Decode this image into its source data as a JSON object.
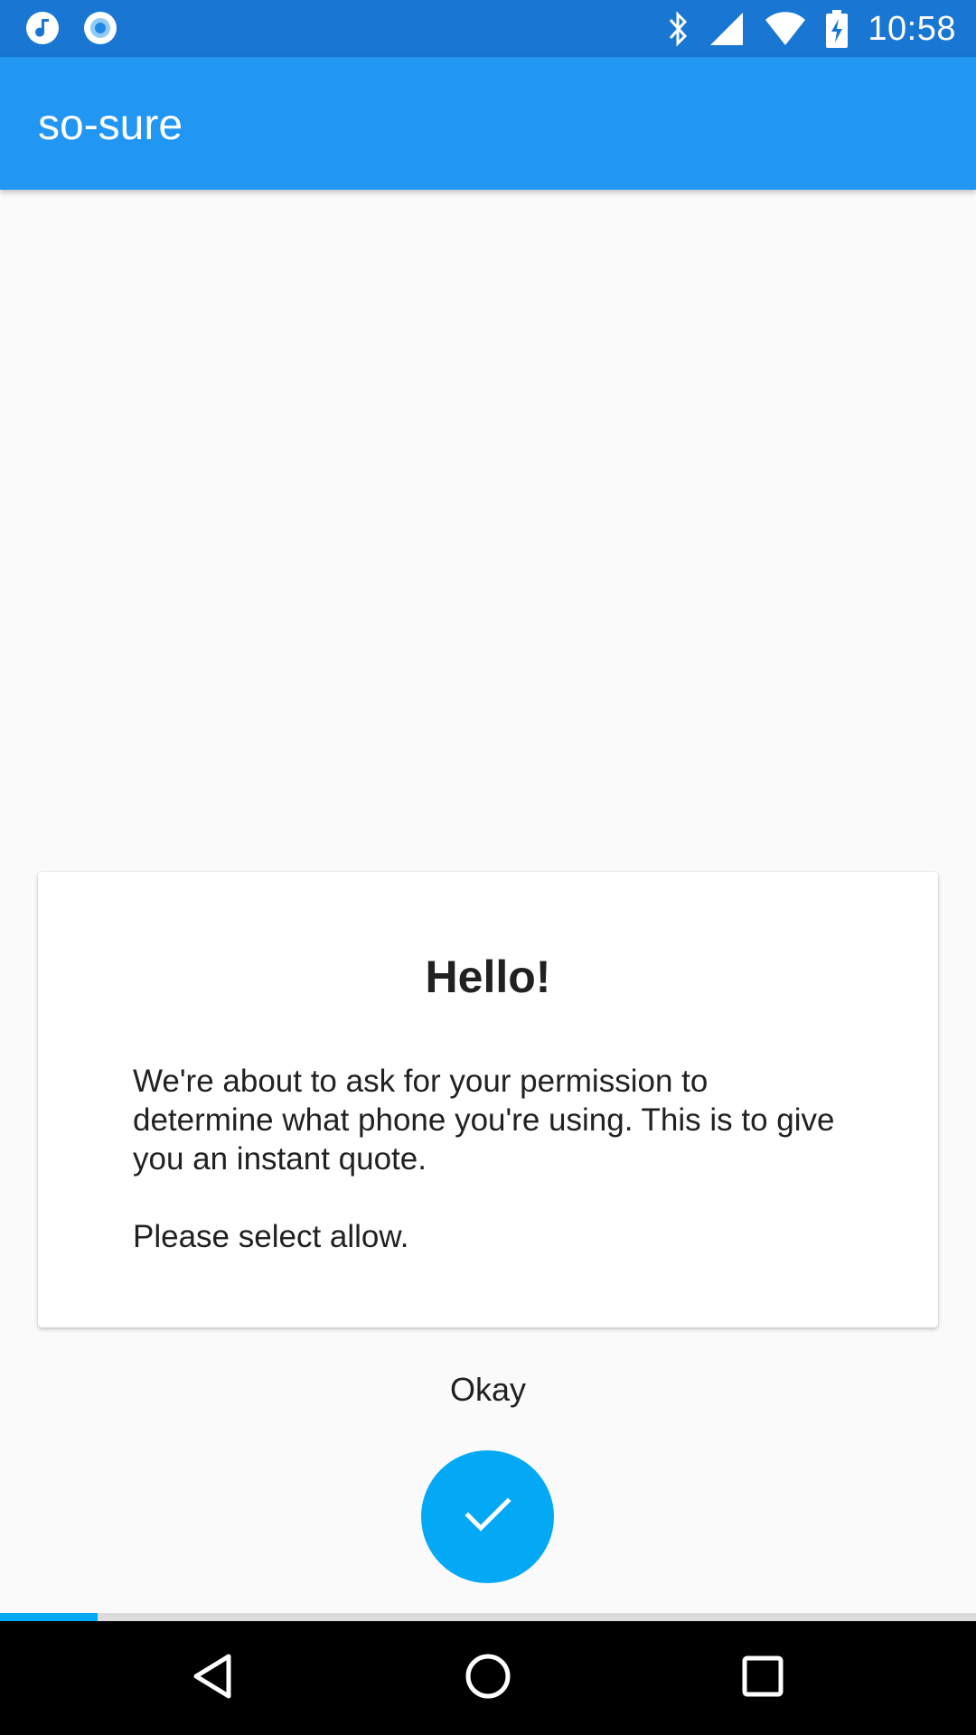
{
  "status_bar": {
    "time": "10:58",
    "left_icons": [
      "music-note-icon",
      "record-icon"
    ],
    "right_icons": [
      "bluetooth-icon",
      "cell-signal-icon",
      "wifi-icon",
      "battery-charging-icon"
    ],
    "color": "#1976d2"
  },
  "app_bar": {
    "title": "so-sure",
    "color": "#2196f3"
  },
  "card": {
    "title": "Hello!",
    "body_paragraphs": [
      "We're about to ask for your permission to determine what phone you're using. This is to give you an instant quote.",
      "Please select allow."
    ]
  },
  "action": {
    "label": "Okay",
    "fab_icon": "check-icon",
    "fab_color": "#03a9f4"
  },
  "progress": {
    "fraction": 0.1
  },
  "nav_bar": {
    "buttons": [
      "back-icon",
      "home-icon",
      "recents-icon"
    ]
  }
}
